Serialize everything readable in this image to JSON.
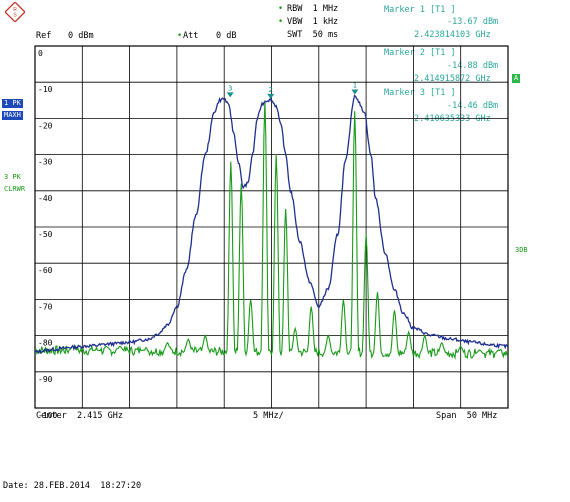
{
  "header": {
    "ref_label": "Ref",
    "ref_value": "0 dBm",
    "att_label": "Att",
    "att_value": "0 dB",
    "rbw": "RBW  1 MHz",
    "vbw": "VBW  1 kHz",
    "swt": "SWT  50 ms"
  },
  "markers": [
    {
      "title": "Marker 1 [T1 ]",
      "level": "-13.67 dBm",
      "freq": "2.423814103 GHz",
      "symbol": "1"
    },
    {
      "title": "Marker 2 [T1 ]",
      "level": "-14.88 dBm",
      "freq": "2.414915872 GHz",
      "symbol": "2"
    },
    {
      "title": "Marker 3 [T1 ]",
      "level": "-14.46 dBm",
      "freq": "2.410635333 GHz",
      "symbol": "3"
    }
  ],
  "side_labels": {
    "trace1_line1": "1 PK",
    "trace1_line2": "MAXH",
    "trace3_line1": "3 PK",
    "trace3_line2": "CLRWR",
    "right_a": "A",
    "right_3db": "3DB"
  },
  "footer": {
    "center": "Center  2.415 GHz",
    "per_div": "5 MHz/",
    "span": "Span  50 MHz",
    "date": "Date: 28.FEB.2014  18:27:20"
  },
  "colors": {
    "trace_max_hold": "#1f2f8f",
    "trace_clear_write": "#1a9a1a",
    "marker": "#1a8f8f",
    "grid": "#000000"
  },
  "chart_data": {
    "type": "line",
    "title": "",
    "xlabel": "",
    "ylabel": "",
    "xlim": [
      2.39,
      2.44
    ],
    "ylim": [
      -100,
      0
    ],
    "y_ticks": [
      "0",
      "-10",
      "-20",
      "-30",
      "-40",
      "-50",
      "-60",
      "-70",
      "-80",
      "-90",
      "-100"
    ],
    "grid": true,
    "series": [
      {
        "name": "1 PK MAXH",
        "x": [
          2.39,
          2.392,
          2.394,
          2.396,
          2.398,
          2.4,
          2.402,
          2.403,
          2.404,
          2.405,
          2.406,
          2.407,
          2.408,
          2.409,
          2.4095,
          2.41,
          2.4105,
          2.411,
          2.4115,
          2.412,
          2.4125,
          2.413,
          2.4135,
          2.414,
          2.4145,
          2.4149,
          2.4155,
          2.416,
          2.4165,
          2.417,
          2.418,
          2.419,
          2.42,
          2.421,
          2.422,
          2.4228,
          2.4238,
          2.4248,
          2.4255,
          2.426,
          2.427,
          2.428,
          2.429,
          2.43,
          2.432,
          2.434,
          2.436,
          2.438,
          2.44
        ],
        "y": [
          -84.5,
          -83.8,
          -83.2,
          -82.8,
          -82.3,
          -81.8,
          -81.0,
          -79.5,
          -77.0,
          -72.0,
          -62.0,
          -47.0,
          -30.0,
          -18.0,
          -15.0,
          -14.5,
          -16.5,
          -24.0,
          -32.0,
          -39.0,
          -38.0,
          -30.0,
          -20.0,
          -16.0,
          -15.0,
          -14.9,
          -16.5,
          -22.0,
          -30.0,
          -40.0,
          -54.0,
          -65.0,
          -72.0,
          -67.0,
          -52.0,
          -32.0,
          -13.7,
          -18.0,
          -30.0,
          -42.0,
          -57.0,
          -67.5,
          -74.0,
          -78.0,
          -80.0,
          -81.0,
          -81.8,
          -82.5,
          -83.0
        ]
      },
      {
        "name": "3 PK CLRWR",
        "x": [
          2.39,
          2.4145,
          2.4238,
          2.44
        ],
        "y": [
          -84.0,
          -15.0,
          -18.0,
          -85.0
        ]
      }
    ],
    "markers": [
      {
        "id": "1",
        "x": 2.423814103,
        "y": -13.67
      },
      {
        "id": "2",
        "x": 2.414915872,
        "y": -14.88
      },
      {
        "id": "3",
        "x": 2.410635333,
        "y": -14.46
      }
    ]
  }
}
